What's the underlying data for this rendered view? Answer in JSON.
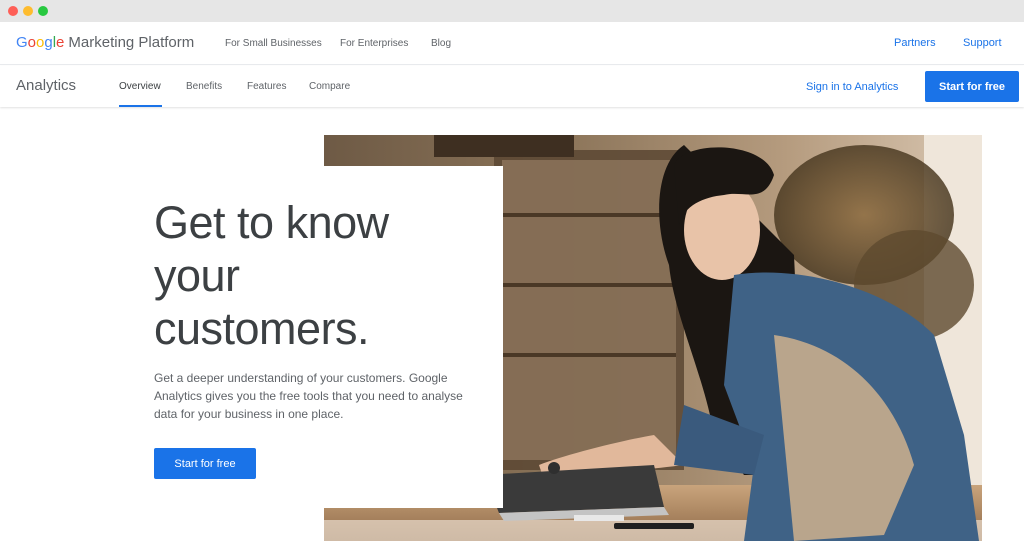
{
  "colors": {
    "accent": "#1a73e8",
    "google_blue": "#4285f4",
    "google_red": "#ea4335",
    "google_yellow": "#fbbc05",
    "google_green": "#34a853"
  },
  "header": {
    "brand_letters": [
      "G",
      "o",
      "o",
      "g",
      "l",
      "e"
    ],
    "brand_product": "Marketing Platform",
    "links": [
      "For Small Businesses",
      "For Enterprises",
      "Blog"
    ],
    "right_links": [
      "Partners",
      "Support"
    ]
  },
  "subnav": {
    "product": "Analytics",
    "tabs": [
      "Overview",
      "Benefits",
      "Features",
      "Compare"
    ],
    "active_tab": "Overview",
    "sign_in": "Sign in to Analytics",
    "start_button": "Start for free"
  },
  "hero": {
    "title_lines": [
      "Get to know",
      "your",
      "customers."
    ],
    "description": "Get a deeper understanding of your customers. Google Analytics gives you the free tools that you need to analyse data for your business in one place.",
    "button": "Start for free",
    "image_icon": "photo-woman-using-laptop"
  }
}
